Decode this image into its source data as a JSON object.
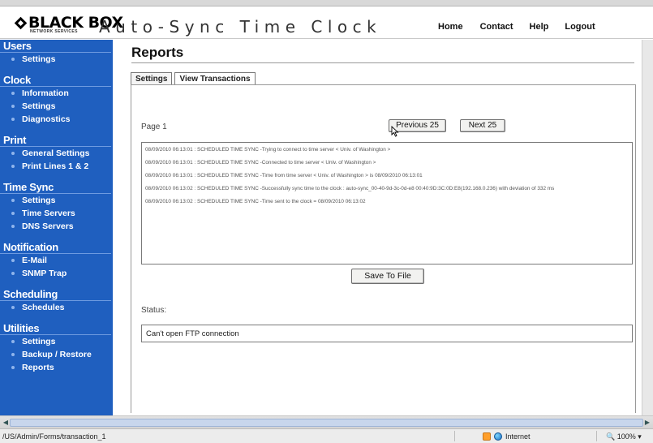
{
  "header": {
    "logo_text": "BLACK BOX",
    "logo_sub": "NETWORK SERVICES",
    "app_title": "Auto-Sync Time Clock",
    "nav": [
      "Home",
      "Contact",
      "Help",
      "Logout"
    ]
  },
  "sidebar": {
    "sections": [
      {
        "title": "Users",
        "items": [
          "Settings"
        ]
      },
      {
        "title": "Clock",
        "items": [
          "Information",
          "Settings",
          "Diagnostics"
        ]
      },
      {
        "title": "Print",
        "items": [
          "General Settings",
          "Print Lines 1 & 2"
        ]
      },
      {
        "title": "Time Sync",
        "items": [
          "Settings",
          "Time Servers",
          "DNS Servers"
        ]
      },
      {
        "title": "Notification",
        "items": [
          "E-Mail",
          "SNMP Trap"
        ]
      },
      {
        "title": "Scheduling",
        "items": [
          "Schedules"
        ]
      },
      {
        "title": "Utilities",
        "items": [
          "Settings",
          "Backup / Restore",
          "Reports"
        ]
      }
    ]
  },
  "main": {
    "title": "Reports",
    "tabs": [
      "Settings",
      "View Transactions"
    ],
    "page_label": "Page  1",
    "prev_button": "Previous 25",
    "next_button": "Next 25",
    "log_lines": [
      "08/09/2010 06:13:01 : SCHEDULED TIME SYNC -Trying to connect to time server < Univ. of Washington >",
      "08/09/2010 06:13:01 : SCHEDULED TIME SYNC -Connected to time server < Univ. of Washington >",
      "08/09/2010 06:13:01 : SCHEDULED TIME SYNC -Time from time server < Univ. of Washington > is 08/09/2010 06:13:01",
      "08/09/2010 06:13:02 : SCHEDULED TIME SYNC -Successfully sync time to the clock : auto-sync_00-40-9d-3c-0d-e8 00:40:9D:3C:0D:E8(192.168.0.236) with deviation of 332 ms",
      "08/09/2010 06:13:02 : SCHEDULED TIME SYNC -Time sent to the clock = 08/09/2010 06:13:02"
    ],
    "save_button": "Save To File",
    "status_label": "Status:",
    "status_value": "Can't open FTP connection"
  },
  "browser": {
    "status_url": "/US/Admin/Forms/transaction_1",
    "zone": "Internet",
    "zoom": "100%"
  },
  "colors": {
    "sidebar_bg": "#1f5fbf",
    "bullet": "#8fb4ec"
  }
}
